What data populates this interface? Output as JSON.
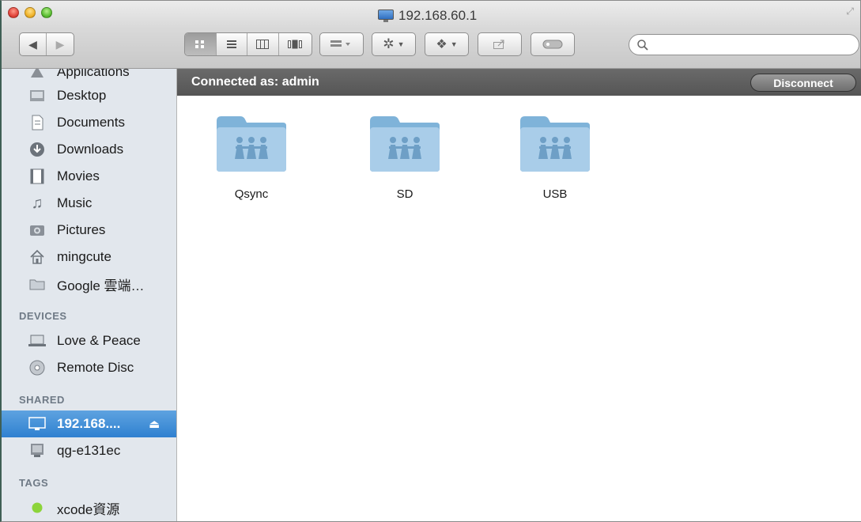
{
  "window": {
    "title": "192.168.60.1"
  },
  "search": {
    "placeholder": ""
  },
  "sidebar": {
    "favorites": [
      {
        "label": "Applications",
        "icon": "applications-icon"
      },
      {
        "label": "Desktop",
        "icon": "desktop-icon"
      },
      {
        "label": "Documents",
        "icon": "documents-icon"
      },
      {
        "label": "Downloads",
        "icon": "downloads-icon"
      },
      {
        "label": "Movies",
        "icon": "movies-icon"
      },
      {
        "label": "Music",
        "icon": "music-icon"
      },
      {
        "label": "Pictures",
        "icon": "pictures-icon"
      },
      {
        "label": "mingcute",
        "icon": "home-icon"
      },
      {
        "label": "Google 雲端…",
        "icon": "folder-icon"
      }
    ],
    "devices_header": "DEVICES",
    "devices": [
      {
        "label": "Love & Peace",
        "icon": "laptop-icon"
      },
      {
        "label": "Remote Disc",
        "icon": "disc-icon"
      }
    ],
    "shared_header": "SHARED",
    "shared": [
      {
        "label": "192.168....",
        "icon": "monitor-icon",
        "selected": true
      },
      {
        "label": "qg-e131ec",
        "icon": "server-icon"
      }
    ],
    "tags_header": "TAGS",
    "tags": [
      {
        "label": "xcode資源",
        "color": "#8cd43a"
      }
    ]
  },
  "content": {
    "connected_label": "Connected as: admin",
    "disconnect_label": "Disconnect",
    "folders": [
      {
        "name": "Qsync"
      },
      {
        "name": "SD"
      },
      {
        "name": "USB"
      }
    ]
  }
}
